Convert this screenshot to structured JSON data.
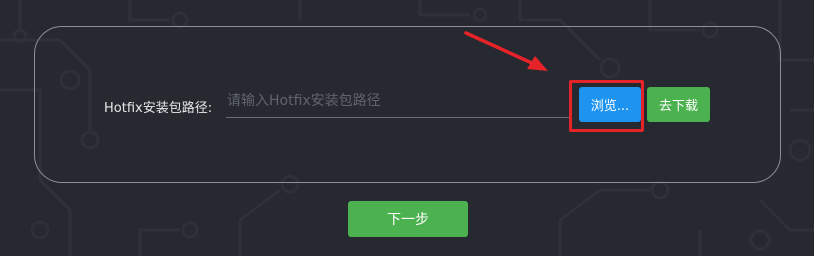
{
  "form": {
    "path_label": "Hotfix安装包路径:",
    "path_value": "",
    "path_placeholder": "请输入Hotfix安装包路径",
    "browse_label": "浏览...",
    "download_label": "去下载"
  },
  "footer": {
    "next_label": "下一步"
  },
  "colors": {
    "background": "#262930",
    "panel_border": "#8d9098",
    "browse": "#1e93f0",
    "success": "#4cb14f",
    "annotation": "#e7232a"
  }
}
